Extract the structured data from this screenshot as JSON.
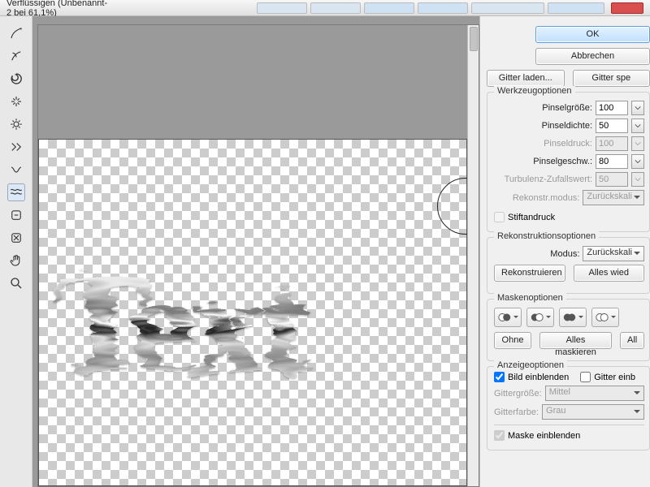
{
  "window": {
    "title": "Verflüssigen (Unbenannt-2 bei 61,1%)"
  },
  "canvas_text": "Text",
  "buttons": {
    "ok": "OK",
    "cancel": "Abbrechen",
    "load_mesh": "Gitter laden...",
    "save_mesh": "Gitter spe",
    "reconstruct": "Rekonstruieren",
    "restore_all": "Alles wied",
    "mask_none": "Ohne",
    "mask_all": "Alles maskieren",
    "mask_invert": "All"
  },
  "groups": {
    "tool_options": "Werkzeugoptionen",
    "reconstruct_options": "Rekonstruktionsoptionen",
    "mask_options": "Maskenoptionen",
    "view_options": "Anzeigeoptionen"
  },
  "tool_options": {
    "brush_size_label": "Pinselgröße:",
    "brush_size": "100",
    "brush_density_label": "Pinseldichte:",
    "brush_density": "50",
    "brush_pressure_label": "Pinseldruck:",
    "brush_pressure": "100",
    "brush_rate_label": "Pinselgeschw.:",
    "brush_rate": "80",
    "turbulence_label": "Turbulenz-Zufallswert:",
    "turbulence": "50",
    "reconstruct_mode_label": "Rekonstr.modus:",
    "reconstruct_mode": "Zurückskali",
    "stylus_label": "Stiftandruck"
  },
  "reconstruct_options": {
    "mode_label": "Modus:",
    "mode": "Zurückskali"
  },
  "view_options": {
    "show_image": "Bild einblenden",
    "show_mesh": "Gitter einb",
    "mesh_size_label": "Gittergröße:",
    "mesh_size": "Mittel",
    "mesh_color_label": "Gitterfarbe:",
    "mesh_color": "Grau",
    "show_mask": "Maske einblenden"
  }
}
